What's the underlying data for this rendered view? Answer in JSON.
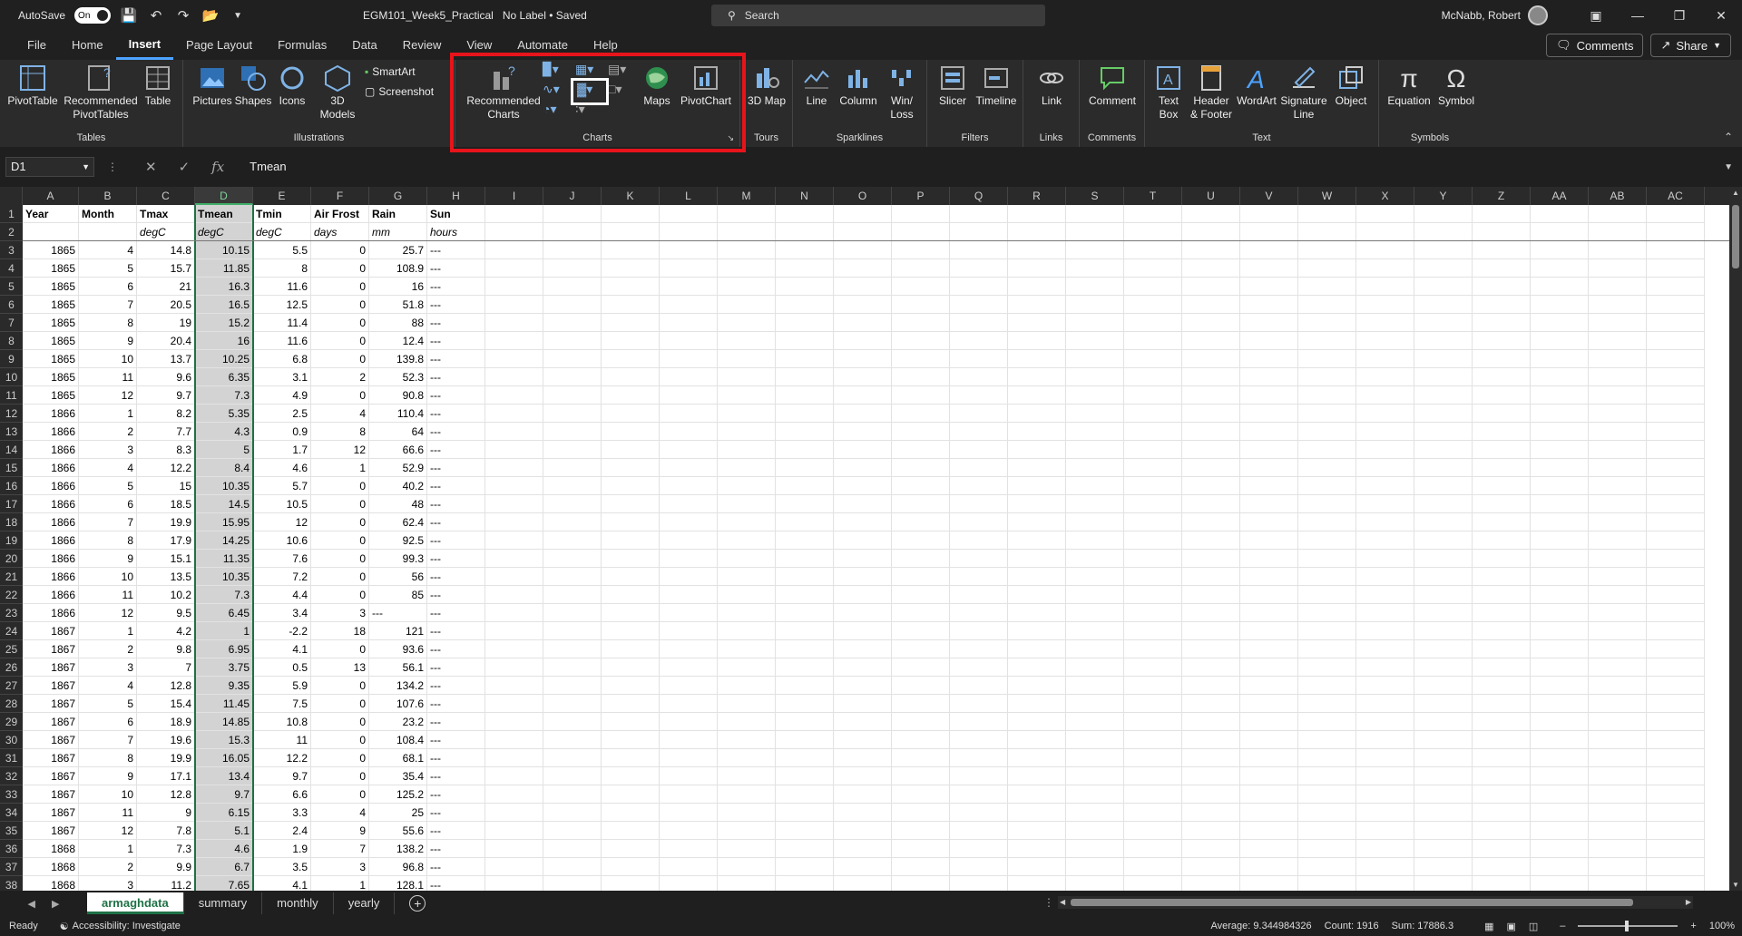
{
  "titlebar": {
    "autosave_label": "AutoSave",
    "autosave_state": "On",
    "filename": "EGM101_Week5_Practical",
    "label_status": "No Label • Saved",
    "search_placeholder": "Search",
    "user_name": "McNabb, Robert"
  },
  "menu": [
    "File",
    "Home",
    "Insert",
    "Page Layout",
    "Formulas",
    "Data",
    "Review",
    "View",
    "Automate",
    "Help"
  ],
  "menu_active": "Insert",
  "menu_right": {
    "comments": "Comments",
    "share": "Share"
  },
  "ribbon": {
    "tables": {
      "label": "Tables",
      "pivottable": "PivotTable",
      "recommended_pivottables": "Recommended PivotTables",
      "table": "Table"
    },
    "illustrations": {
      "label": "Illustrations",
      "pictures": "Pictures",
      "shapes": "Shapes",
      "icons": "Icons",
      "models3d": "3D Models",
      "smartart": "SmartArt",
      "screenshot": "Screenshot"
    },
    "charts": {
      "label": "Charts",
      "recommended_charts": "Recommended Charts",
      "maps": "Maps",
      "pivotchart": "PivotChart"
    },
    "tours": {
      "label": "Tours",
      "map3d": "3D Map"
    },
    "sparklines": {
      "label": "Sparklines",
      "line": "Line",
      "column": "Column",
      "winloss": "Win/ Loss"
    },
    "filters": {
      "label": "Filters",
      "slicer": "Slicer",
      "timeline": "Timeline"
    },
    "links": {
      "label": "Links",
      "link": "Link"
    },
    "comments": {
      "label": "Comments",
      "comment": "Comment"
    },
    "text": {
      "label": "Text",
      "textbox": "Text Box",
      "header_footer": "Header & Footer",
      "wordart": "WordArt",
      "signature": "Signature Line",
      "object": "Object"
    },
    "symbols": {
      "label": "Symbols",
      "equation": "Equation",
      "symbol": "Symbol"
    }
  },
  "formula_bar": {
    "name_box": "D1",
    "formula": "Tmean"
  },
  "columns": [
    "A",
    "B",
    "C",
    "D",
    "E",
    "F",
    "G",
    "H",
    "I",
    "J",
    "K",
    "L",
    "M",
    "N",
    "O",
    "P",
    "Q",
    "R",
    "S",
    "T",
    "U",
    "V",
    "W",
    "X",
    "Y",
    "Z",
    "AA",
    "AB",
    "AC"
  ],
  "headers": [
    "Year",
    "Month",
    "Tmax",
    "Tmean",
    "Tmin",
    "Air Frost",
    "Rain",
    "Sun"
  ],
  "units": [
    "",
    "",
    "degC",
    "degC",
    "degC",
    "days",
    "mm",
    "hours"
  ],
  "rows": [
    [
      "1865",
      "4",
      "14.8",
      "10.15",
      "5.5",
      "0",
      "25.7",
      "---"
    ],
    [
      "1865",
      "5",
      "15.7",
      "11.85",
      "8",
      "0",
      "108.9",
      "---"
    ],
    [
      "1865",
      "6",
      "21",
      "16.3",
      "11.6",
      "0",
      "16",
      "---"
    ],
    [
      "1865",
      "7",
      "20.5",
      "16.5",
      "12.5",
      "0",
      "51.8",
      "---"
    ],
    [
      "1865",
      "8",
      "19",
      "15.2",
      "11.4",
      "0",
      "88",
      "---"
    ],
    [
      "1865",
      "9",
      "20.4",
      "16",
      "11.6",
      "0",
      "12.4",
      "---"
    ],
    [
      "1865",
      "10",
      "13.7",
      "10.25",
      "6.8",
      "0",
      "139.8",
      "---"
    ],
    [
      "1865",
      "11",
      "9.6",
      "6.35",
      "3.1",
      "2",
      "52.3",
      "---"
    ],
    [
      "1865",
      "12",
      "9.7",
      "7.3",
      "4.9",
      "0",
      "90.8",
      "---"
    ],
    [
      "1866",
      "1",
      "8.2",
      "5.35",
      "2.5",
      "4",
      "110.4",
      "---"
    ],
    [
      "1866",
      "2",
      "7.7",
      "4.3",
      "0.9",
      "8",
      "64",
      "---"
    ],
    [
      "1866",
      "3",
      "8.3",
      "5",
      "1.7",
      "12",
      "66.6",
      "---"
    ],
    [
      "1866",
      "4",
      "12.2",
      "8.4",
      "4.6",
      "1",
      "52.9",
      "---"
    ],
    [
      "1866",
      "5",
      "15",
      "10.35",
      "5.7",
      "0",
      "40.2",
      "---"
    ],
    [
      "1866",
      "6",
      "18.5",
      "14.5",
      "10.5",
      "0",
      "48",
      "---"
    ],
    [
      "1866",
      "7",
      "19.9",
      "15.95",
      "12",
      "0",
      "62.4",
      "---"
    ],
    [
      "1866",
      "8",
      "17.9",
      "14.25",
      "10.6",
      "0",
      "92.5",
      "---"
    ],
    [
      "1866",
      "9",
      "15.1",
      "11.35",
      "7.6",
      "0",
      "99.3",
      "---"
    ],
    [
      "1866",
      "10",
      "13.5",
      "10.35",
      "7.2",
      "0",
      "56",
      "---"
    ],
    [
      "1866",
      "11",
      "10.2",
      "7.3",
      "4.4",
      "0",
      "85",
      "---"
    ],
    [
      "1866",
      "12",
      "9.5",
      "6.45",
      "3.4",
      "3",
      "---",
      "---"
    ],
    [
      "1867",
      "1",
      "4.2",
      "1",
      "-2.2",
      "18",
      "121",
      "---"
    ],
    [
      "1867",
      "2",
      "9.8",
      "6.95",
      "4.1",
      "0",
      "93.6",
      "---"
    ],
    [
      "1867",
      "3",
      "7",
      "3.75",
      "0.5",
      "13",
      "56.1",
      "---"
    ],
    [
      "1867",
      "4",
      "12.8",
      "9.35",
      "5.9",
      "0",
      "134.2",
      "---"
    ],
    [
      "1867",
      "5",
      "15.4",
      "11.45",
      "7.5",
      "0",
      "107.6",
      "---"
    ],
    [
      "1867",
      "6",
      "18.9",
      "14.85",
      "10.8",
      "0",
      "23.2",
      "---"
    ],
    [
      "1867",
      "7",
      "19.6",
      "15.3",
      "11",
      "0",
      "108.4",
      "---"
    ],
    [
      "1867",
      "8",
      "19.9",
      "16.05",
      "12.2",
      "0",
      "68.1",
      "---"
    ],
    [
      "1867",
      "9",
      "17.1",
      "13.4",
      "9.7",
      "0",
      "35.4",
      "---"
    ],
    [
      "1867",
      "10",
      "12.8",
      "9.7",
      "6.6",
      "0",
      "125.2",
      "---"
    ],
    [
      "1867",
      "11",
      "9",
      "6.15",
      "3.3",
      "4",
      "25",
      "---"
    ],
    [
      "1867",
      "12",
      "7.8",
      "5.1",
      "2.4",
      "9",
      "55.6",
      "---"
    ],
    [
      "1868",
      "1",
      "7.3",
      "4.6",
      "1.9",
      "7",
      "138.2",
      "---"
    ],
    [
      "1868",
      "2",
      "9.9",
      "6.7",
      "3.5",
      "3",
      "96.8",
      "---"
    ],
    [
      "1868",
      "3",
      "11.2",
      "7.65",
      "4.1",
      "1",
      "128.1",
      "---"
    ]
  ],
  "sheets": [
    "armaghdata",
    "summary",
    "monthly",
    "yearly"
  ],
  "active_sheet": "armaghdata",
  "status": {
    "ready": "Ready",
    "accessibility": "Accessibility: Investigate",
    "average": "Average: 9.344984326",
    "count": "Count: 1916",
    "sum": "Sum: 17886.3",
    "zoom": "100%"
  }
}
